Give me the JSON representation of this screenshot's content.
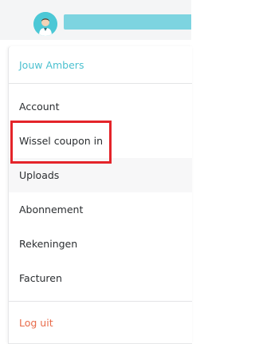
{
  "header": {
    "avatar_icon": "user-avatar-icon"
  },
  "dropdown": {
    "title": "Jouw Ambers",
    "items": [
      {
        "label": "Account"
      },
      {
        "label": "Wissel coupon in"
      },
      {
        "label": "Uploads"
      },
      {
        "label": "Abonnement"
      },
      {
        "label": "Rekeningen"
      },
      {
        "label": "Facturen"
      }
    ],
    "logout_label": "Log uit"
  },
  "colors": {
    "accent": "#4cc1d0",
    "logout": "#e86b4a",
    "highlight_border": "#e4242a"
  }
}
